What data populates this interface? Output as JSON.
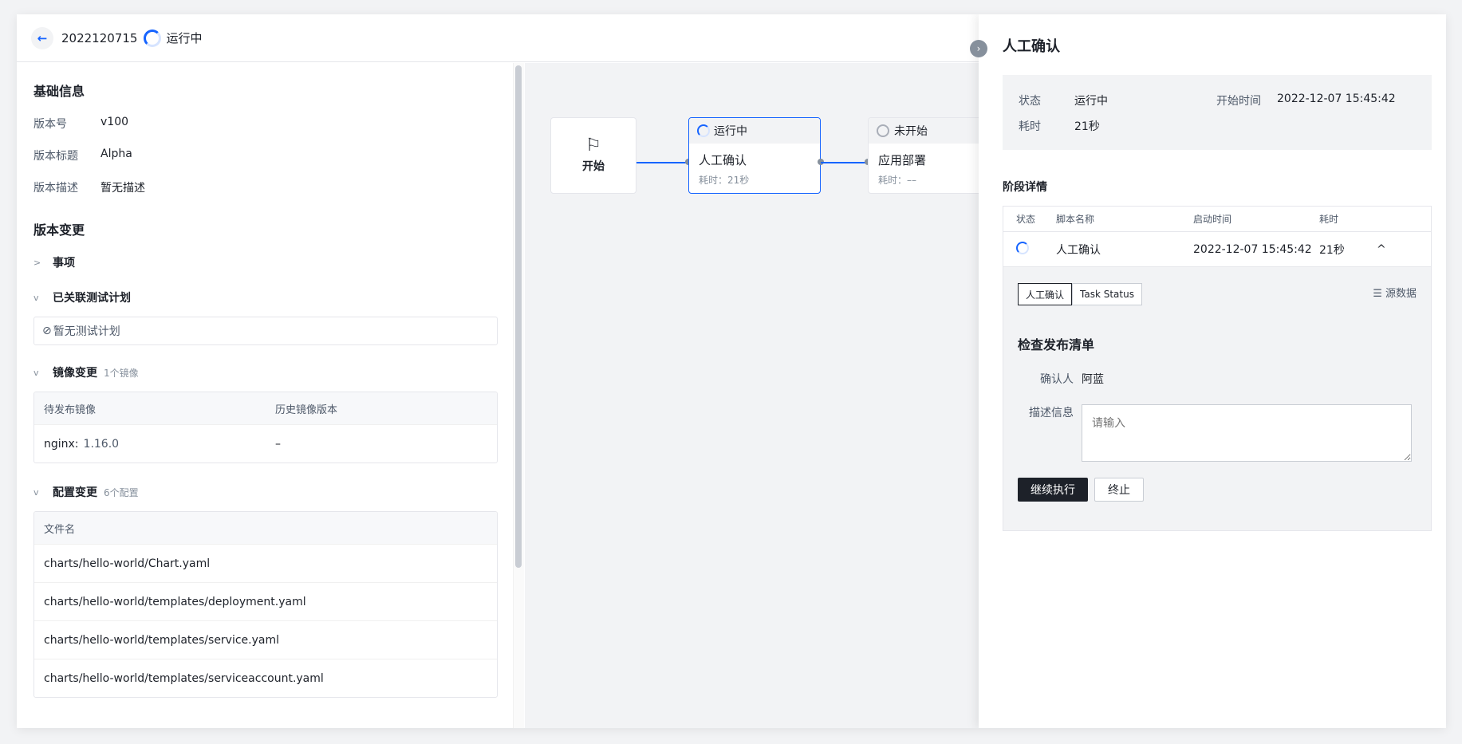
{
  "header": {
    "id": "2022120715",
    "status": "运行中"
  },
  "basic": {
    "title": "基础信息",
    "version_no_label": "版本号",
    "version_no": "v100",
    "version_title_label": "版本标题",
    "version_title": "Alpha",
    "version_desc_label": "版本描述",
    "version_desc": "暂无描述"
  },
  "changes": {
    "title": "版本变更",
    "issues": "事项",
    "test_plan": "已关联测试计划",
    "test_plan_empty": "暂无测试计划",
    "image_title": "镜像变更",
    "image_count": "1个镜像",
    "image_cols": [
      "待发布镜像",
      "历史镜像版本"
    ],
    "image_rows": [
      {
        "name": "nginx:",
        "tag": "1.16.0",
        "history": "–"
      }
    ],
    "config_title": "配置变更",
    "config_count": "6个配置",
    "config_col": "文件名",
    "config_files": [
      "charts/hello-world/Chart.yaml",
      "charts/hello-world/templates/deployment.yaml",
      "charts/hello-world/templates/service.yaml",
      "charts/hello-world/templates/serviceaccount.yaml"
    ]
  },
  "pipeline": {
    "start": "开始",
    "nodes": [
      {
        "status": "运行中",
        "title": "人工确认",
        "duration": "耗时：21秒"
      },
      {
        "status": "未开始",
        "title": "应用部署",
        "duration": "耗时：––"
      }
    ]
  },
  "drawer": {
    "title": "人工确认",
    "status_label": "状态",
    "status": "运行中",
    "start_label": "开始时间",
    "start_time": "2022-12-07 15:45:42",
    "duration_label": "耗时",
    "duration": "21秒",
    "stage_title": "阶段详情",
    "stage_cols": [
      "状态",
      "脚本名称",
      "启动时间",
      "耗时"
    ],
    "stage_row": {
      "name": "人工确认",
      "time": "2022-12-07 15:45:42",
      "duration": "21秒"
    },
    "tabs": [
      "人工确认",
      "Task Status"
    ],
    "src_data": "源数据",
    "check_title": "检查发布清单",
    "confirmer_label": "确认人",
    "confirmer": "阿蓝",
    "desc_label": "描述信息",
    "desc_placeholder": "请输入",
    "continue_btn": "继续执行",
    "stop_btn": "终止"
  }
}
